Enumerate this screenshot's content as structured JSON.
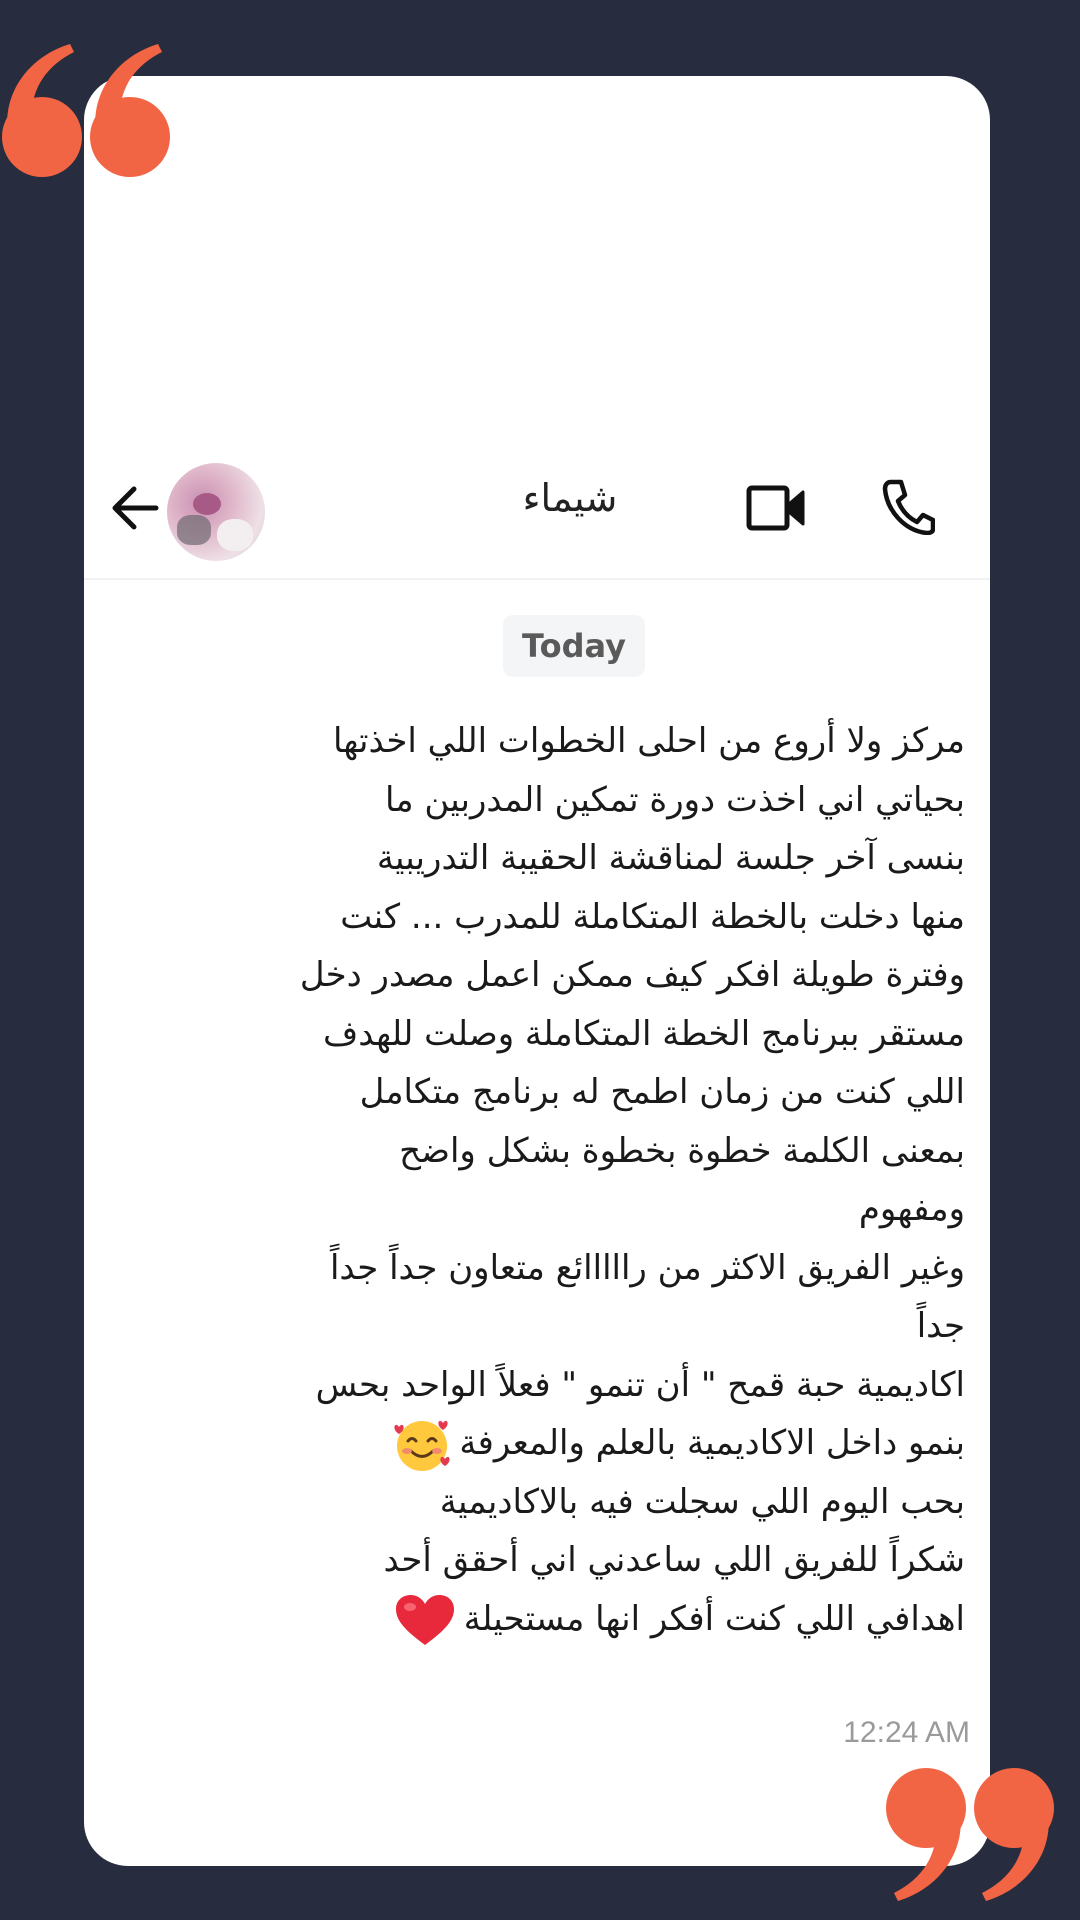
{
  "colors": {
    "background": "#272c3e",
    "card": "#ffffff",
    "quote_marks": "#f26544"
  },
  "icons": {
    "quote_open": "left-double-quote-icon",
    "quote_close": "right-double-quote-icon",
    "back": "arrow-left-icon",
    "video": "video-camera-icon",
    "phone": "phone-icon",
    "emoji_1": "smiling-face-with-hearts-emoji",
    "emoji_2": "red-heart-emoji"
  },
  "header": {
    "contact_name": "شيماء"
  },
  "chat": {
    "date_label": "Today",
    "message_lines": [
      "مركز ولا أروع من احلى الخطوات اللي اخذتها",
      "بحياتي اني اخذت دورة تمكين المدربين ما",
      "بنسى آخر جلسة لمناقشة الحقيبة التدريبية",
      "منها دخلت بالخطة المتكاملة للمدرب ... كنت",
      "وفترة طويلة افكر كيف ممكن اعمل مصدر دخل",
      "مستقر ببرنامج الخطة المتكاملة  وصلت للهدف",
      "اللي كنت من زمان اطمح له برنامج متكامل",
      "بمعنى الكلمة خطوة بخطوة بشكل واضح",
      "ومفهوم",
      "وغير الفريق الاكثر من رااااائع متعاون جداً جداً",
      "جداً",
      "اكاديمية حبة قمح \" أن تنمو \" فعلاً الواحد بحس",
      "بنمو داخل الاكاديمية بالعلم والمعرفة",
      "بحب اليوم اللي سجلت فيه بالاكاديمية",
      "شكراً للفريق اللي ساعدني اني أحقق أحد",
      "اهدافي اللي كنت أفكر انها مستحيلة"
    ],
    "timestamp": "12:24 AM"
  }
}
